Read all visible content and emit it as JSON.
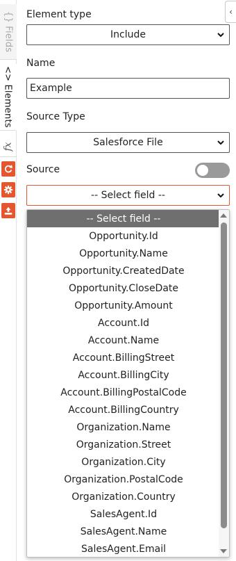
{
  "rail": {
    "tabs": [
      {
        "label": "{} Fields"
      },
      {
        "label": "<> Elements"
      },
      {
        "label": "fx"
      }
    ]
  },
  "form": {
    "element_type": {
      "label": "Element type",
      "value": "Include"
    },
    "name": {
      "label": "Name",
      "value": "Example"
    },
    "source_type": {
      "label": "Source Type",
      "value": "Salesforce File"
    },
    "source": {
      "label": "Source",
      "toggle_on": false,
      "value": "-- Select field --"
    }
  },
  "dropdown": {
    "options": [
      "-- Select field --",
      "Opportunity.Id",
      "Opportunity.Name",
      "Opportunity.CreatedDate",
      "Opportunity.CloseDate",
      "Opportunity.Amount",
      "Account.Id",
      "Account.Name",
      "Account.BillingStreet",
      "Account.BillingCity",
      "Account.BillingPostalCode",
      "Account.BillingCountry",
      "Organization.Name",
      "Organization.Street",
      "Organization.City",
      "Organization.PostalCode",
      "Organization.Country",
      "SalesAgent.Id",
      "SalesAgent.Name",
      "SalesAgent.Email"
    ],
    "selected_index": 0
  },
  "colors": {
    "accent": "#e4572e",
    "selected_bg": "#6f6f6f",
    "toggle_off": "#9a9a9a"
  }
}
